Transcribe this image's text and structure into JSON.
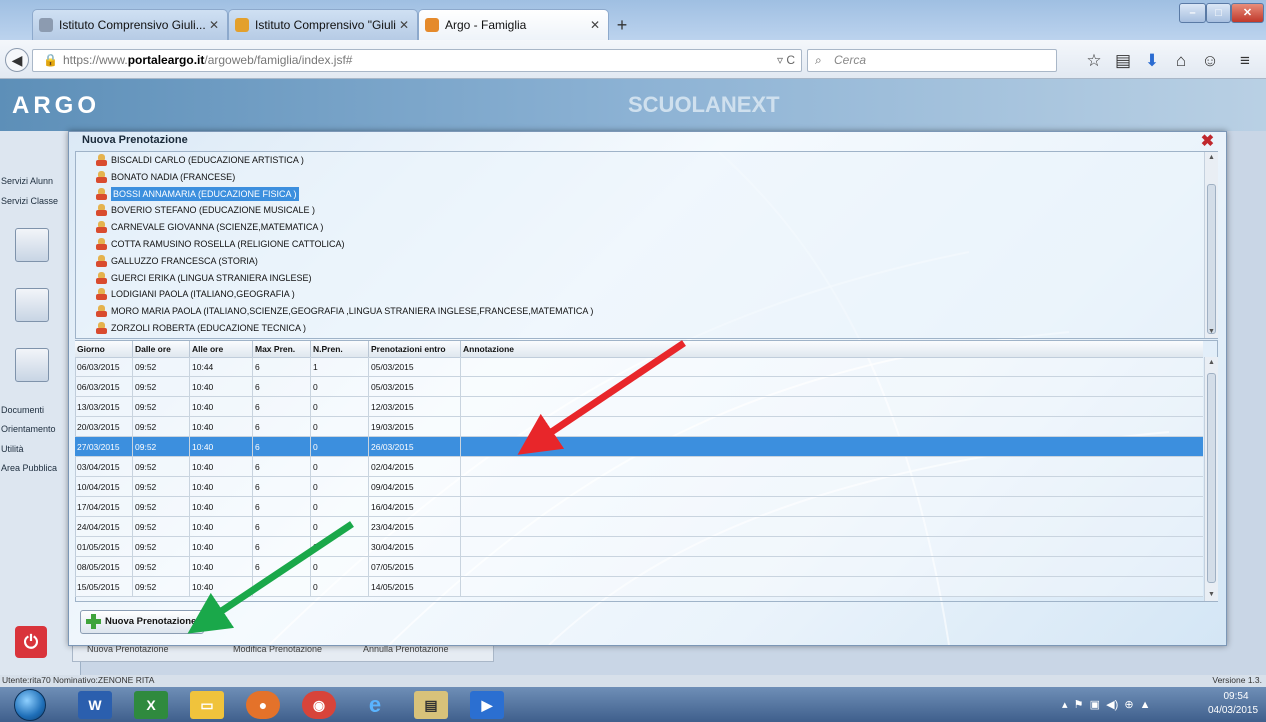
{
  "browser": {
    "tabs": [
      {
        "label": "Istituto Comprensivo Giuli...",
        "active": false
      },
      {
        "label": "Istituto Comprensivo \"Giuli...",
        "active": false
      },
      {
        "label": "Argo - Famiglia",
        "active": true
      }
    ],
    "new_tab": "+",
    "url_prefix": "https://www.",
    "url_domain": "portaleargo.it",
    "url_path": "/argoweb/famiglia/index.jsf#",
    "search_placeholder": "Cerca"
  },
  "app": {
    "logo": "ARGO",
    "brand": "SCUOLANEXT",
    "sidebar": [
      "Servizi Alunn",
      "Servizi Classe",
      "Documenti",
      "Orientamento",
      "Utilità",
      "Area Pubblica"
    ],
    "bottom_buttons": [
      "Nuova Prenotazione",
      "Modifica Prenotazione",
      "Annulla Prenotazione"
    ],
    "status_user": "Utente:rita70 Nominativo:ZENONE RITA",
    "version": "Versione 1.3."
  },
  "modal": {
    "title": "Nuova Prenotazione",
    "teachers": [
      "BISCALDI CARLO (EDUCAZIONE ARTISTICA )",
      "BONATO NADIA (FRANCESE)",
      "BOSSI ANNAMARIA (EDUCAZIONE FISICA )",
      "BOVERIO STEFANO (EDUCAZIONE MUSICALE )",
      "CARNEVALE GIOVANNA (SCIENZE,MATEMATICA )",
      "COTTA RAMUSINO ROSELLA (RELIGIONE CATTOLICA)",
      "GALLUZZO FRANCESCA (STORIA)",
      "GUERCI ERIKA (LINGUA STRANIERA INGLESE)",
      "LODIGIANI PAOLA (ITALIANO,GEOGRAFIA )",
      "MORO MARIA PAOLA (ITALIANO,SCIENZE,GEOGRAFIA ,LINGUA STRANIERA INGLESE,FRANCESE,MATEMATICA )",
      "ZORZOLI ROBERTA (EDUCAZIONE TECNICA )"
    ],
    "selected_teacher": 2,
    "columns": [
      "Giorno",
      "Dalle ore",
      "Alle ore",
      "Max Pren.",
      "N.Pren.",
      "Prenotazioni entro",
      "Annotazione"
    ],
    "rows": [
      [
        "06/03/2015",
        "09:52",
        "10:44",
        "6",
        "1",
        "05/03/2015",
        ""
      ],
      [
        "06/03/2015",
        "09:52",
        "10:40",
        "6",
        "0",
        "05/03/2015",
        ""
      ],
      [
        "13/03/2015",
        "09:52",
        "10:40",
        "6",
        "0",
        "12/03/2015",
        ""
      ],
      [
        "20/03/2015",
        "09:52",
        "10:40",
        "6",
        "0",
        "19/03/2015",
        ""
      ],
      [
        "27/03/2015",
        "09:52",
        "10:40",
        "6",
        "0",
        "26/03/2015",
        ""
      ],
      [
        "03/04/2015",
        "09:52",
        "10:40",
        "6",
        "0",
        "02/04/2015",
        ""
      ],
      [
        "10/04/2015",
        "09:52",
        "10:40",
        "6",
        "0",
        "09/04/2015",
        ""
      ],
      [
        "17/04/2015",
        "09:52",
        "10:40",
        "6",
        "0",
        "16/04/2015",
        ""
      ],
      [
        "24/04/2015",
        "09:52",
        "10:40",
        "6",
        "0",
        "23/04/2015",
        ""
      ],
      [
        "01/05/2015",
        "09:52",
        "10:40",
        "6",
        "0",
        "30/04/2015",
        ""
      ],
      [
        "08/05/2015",
        "09:52",
        "10:40",
        "6",
        "0",
        "07/05/2015",
        ""
      ],
      [
        "15/05/2015",
        "09:52",
        "10:40",
        "6",
        "0",
        "14/05/2015",
        ""
      ]
    ],
    "selected_row": 4,
    "button_label": "Nuova Prenotazione"
  },
  "taskbar": {
    "time": "09:54",
    "date": "04/03/2015"
  },
  "colors": {
    "selection": "#3c8fde",
    "arrow_red": "#e8262a",
    "arrow_green": "#1aa84a"
  }
}
